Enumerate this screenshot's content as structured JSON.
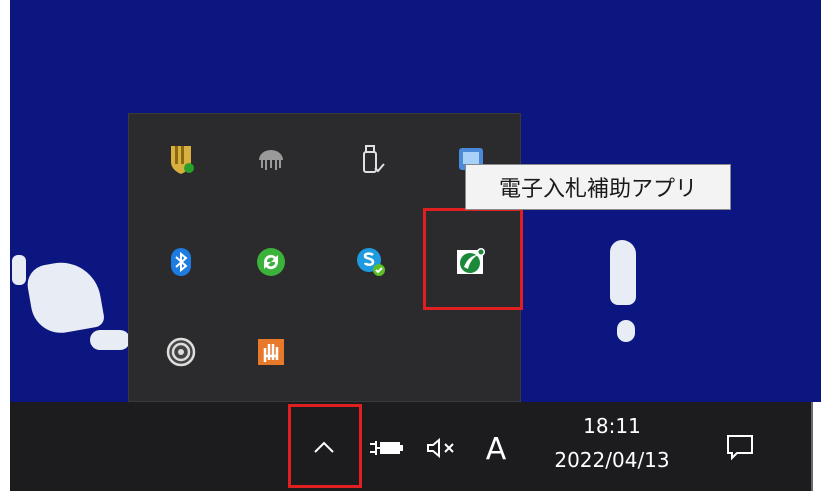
{
  "tooltip": {
    "text": "電子入札補助アプリ"
  },
  "taskbar": {
    "show_hidden_icons": "^",
    "ime_indicator": "A",
    "clock": {
      "time": "18:11",
      "date": "2022/04/13"
    }
  },
  "tray_icons": [
    {
      "name": "security-shield-icon"
    },
    {
      "name": "cloud-jellyfish-icon"
    },
    {
      "name": "usb-safely-remove-icon"
    },
    {
      "name": "network-monitor-icon"
    },
    {
      "name": "bluetooth-icon"
    },
    {
      "name": "sync-green-icon"
    },
    {
      "name": "skype-icon"
    },
    {
      "name": "e-bidding-app-icon"
    },
    {
      "name": "target-swirl-icon"
    },
    {
      "name": "orange-hand-icon"
    }
  ],
  "colors": {
    "highlight": "#e02020",
    "desktop": "#0b1680",
    "taskbar": "#1c1c1f"
  }
}
